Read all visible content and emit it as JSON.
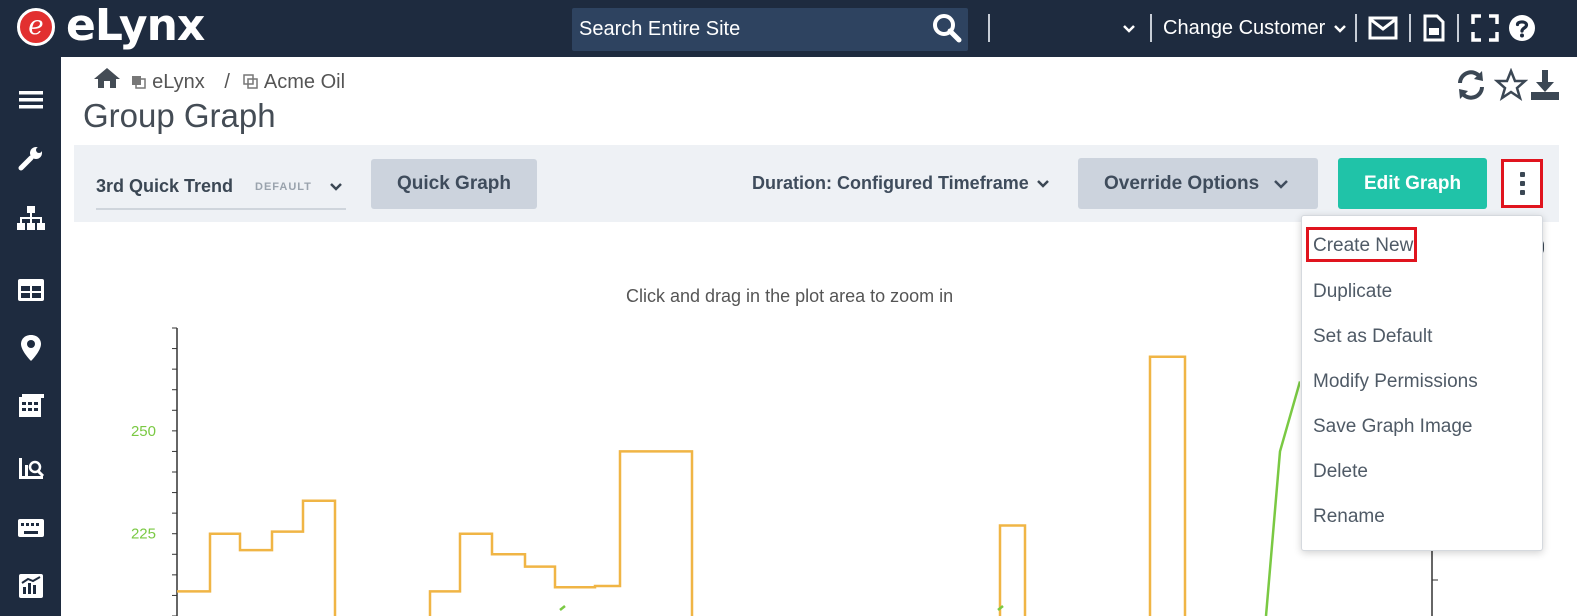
{
  "header": {
    "logo_letter": "e",
    "logo_text": "eLynx",
    "search_placeholder": "Search Entire Site",
    "change_customer_label": "Change Customer"
  },
  "breadcrumb": {
    "home": "",
    "items": [
      "eLynx",
      "Acme Oil"
    ],
    "separator": "/"
  },
  "page": {
    "title": "Group Graph"
  },
  "toolbar": {
    "trend_name": "3rd Quick Trend",
    "trend_badge": "DEFAULT",
    "quick_graph_label": "Quick Graph",
    "duration_label": "Duration:",
    "duration_value": "Configured Timeframe",
    "override_label": "Override Options",
    "edit_graph_label": "Edit Graph"
  },
  "menu": {
    "items": [
      "Create New",
      "Duplicate",
      "Set as Default",
      "Modify Permissions",
      "Save Graph Image",
      "Delete",
      "Rename"
    ]
  },
  "chart": {
    "hint": "Click and drag in the plot area to zoom in"
  },
  "chart_data": {
    "type": "line",
    "y_ticks": [
      {
        "value": 250,
        "label": "250"
      },
      {
        "value": 225,
        "label": "225"
      }
    ],
    "ylim": [
      205,
      275
    ],
    "series": [
      {
        "color": "#f0b545",
        "step": true,
        "points": [
          [
            0,
            211
          ],
          [
            1,
            225
          ],
          [
            2,
            221
          ],
          [
            3,
            225.5
          ],
          [
            4,
            233
          ],
          [
            5,
            201
          ],
          [
            6,
            201
          ],
          [
            7,
            201
          ],
          [
            8,
            211
          ],
          [
            9,
            225
          ],
          [
            10,
            220
          ],
          [
            11,
            217
          ],
          [
            12,
            212
          ],
          [
            13,
            212.3
          ],
          [
            14,
            245
          ],
          [
            15,
            201
          ],
          [
            16,
            201
          ],
          [
            17,
            201
          ],
          [
            18,
            201
          ],
          [
            19,
            201
          ],
          [
            20,
            201
          ],
          [
            21,
            227
          ],
          [
            22,
            201
          ],
          [
            23,
            201
          ],
          [
            24,
            201
          ],
          [
            25,
            268
          ],
          [
            26,
            201
          ]
        ]
      },
      {
        "color": "#7ac943",
        "step": false,
        "points": [
          [
            0,
            201
          ],
          [
            26,
            201
          ],
          [
            27,
            245
          ],
          [
            28,
            262
          ]
        ]
      }
    ],
    "colors": {
      "orange": "#f0b545",
      "green": "#7ac943",
      "tick_label": "#7ac943"
    }
  },
  "colors": {
    "topbar": "#1e2b3f",
    "accent": "#20c3a8",
    "highlight": "#e0141e"
  }
}
